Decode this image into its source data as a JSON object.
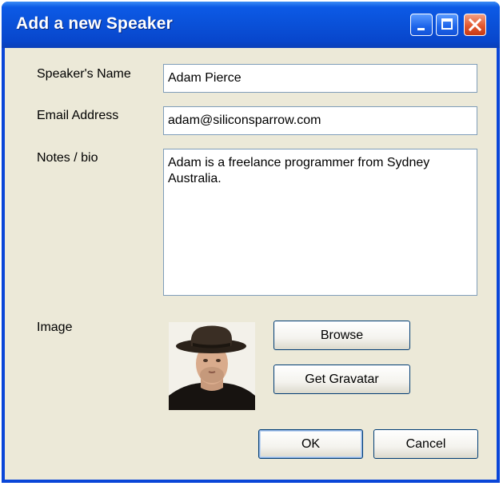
{
  "window": {
    "title": "Add a new Speaker",
    "controls": [
      "minimize-icon",
      "maximize-icon",
      "close-icon"
    ]
  },
  "form": {
    "name_label": "Speaker's Name",
    "name_value": "Adam Pierce",
    "email_label": "Email Address",
    "email_value": "adam@siliconsparrow.com",
    "notes_label": "Notes / bio",
    "notes_value": "Adam is a freelance programmer from Sydney Australia.",
    "image_label": "Image"
  },
  "buttons": {
    "browse": "Browse",
    "gravatar": "Get Gravatar",
    "ok": "OK",
    "cancel": "Cancel"
  },
  "colors": {
    "titlebar": "#0a4fd6",
    "client_bg": "#ece9d8",
    "close_button": "#e2582f"
  }
}
